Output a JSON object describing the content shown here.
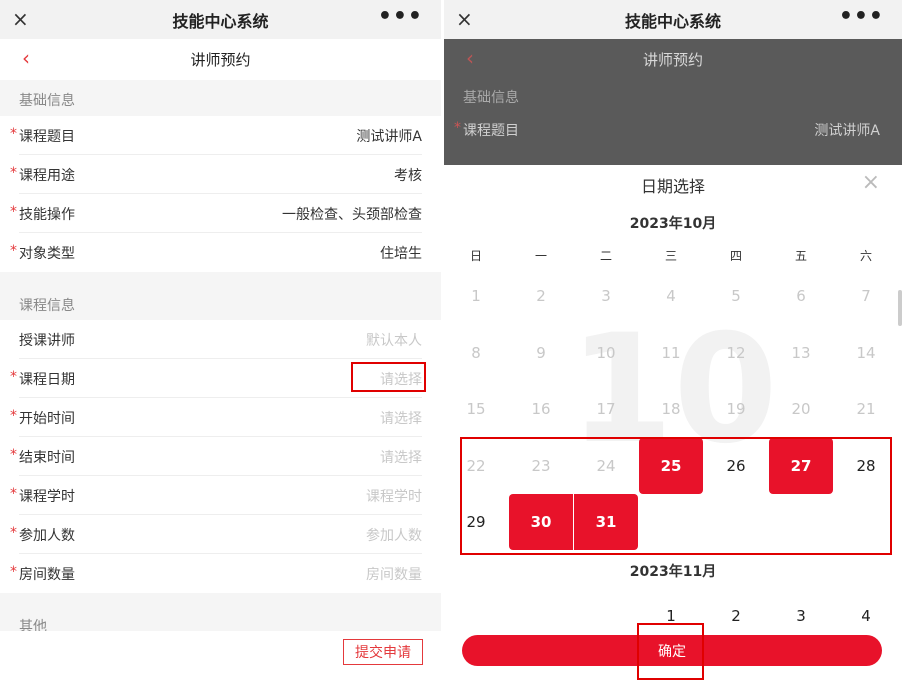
{
  "app": {
    "title": "技能中心系统",
    "close_icon": "×",
    "more_icon": "•••"
  },
  "nav": {
    "back_icon": "‹",
    "title": "讲师预约"
  },
  "form": {
    "basic": {
      "header": "基础信息",
      "rows": [
        {
          "label": "课程题目",
          "value": "测试讲师A"
        },
        {
          "label": "课程用途",
          "value": "考核"
        },
        {
          "label": "技能操作",
          "value": "一般检查、头颈部检查"
        },
        {
          "label": "对象类型",
          "value": "住培生"
        }
      ]
    },
    "course": {
      "header": "课程信息",
      "rows": [
        {
          "label": "授课讲师",
          "placeholder": "默认本人"
        },
        {
          "label": "课程日期",
          "placeholder": "请选择"
        },
        {
          "label": "开始时间",
          "placeholder": "请选择"
        },
        {
          "label": "结束时间",
          "placeholder": "请选择"
        },
        {
          "label": "课程学时",
          "placeholder": "课程学时"
        },
        {
          "label": "参加人数",
          "placeholder": "参加人数"
        },
        {
          "label": "房间数量",
          "placeholder": "房间数量"
        }
      ]
    },
    "other": {
      "header": "其他"
    },
    "required_mark": "*",
    "submit_label": "提交申请"
  },
  "picker": {
    "title": "日期选择",
    "close_icon": "×",
    "weekdays": [
      "日",
      "一",
      "二",
      "三",
      "四",
      "五",
      "六"
    ],
    "month1": {
      "label": "2023年10月",
      "watermark": "10"
    },
    "month2": {
      "label": "2023年11月"
    },
    "october_days": [
      [
        "1",
        "2",
        "3",
        "4",
        "5",
        "6",
        "7"
      ],
      [
        "8",
        "9",
        "10",
        "11",
        "12",
        "13",
        "14"
      ],
      [
        "15",
        "16",
        "17",
        "18",
        "19",
        "20",
        "21"
      ],
      [
        "22",
        "23",
        "24",
        "25",
        "26",
        "27",
        "28"
      ],
      [
        "29",
        "30",
        "31"
      ]
    ],
    "november_first_row": [
      "1",
      "2",
      "3",
      "4"
    ],
    "selected_days": [
      "25",
      "27",
      "30",
      "31"
    ],
    "confirm_label": "确定"
  },
  "colors": {
    "accent": "#e8122a",
    "annotation": "#e00000"
  }
}
